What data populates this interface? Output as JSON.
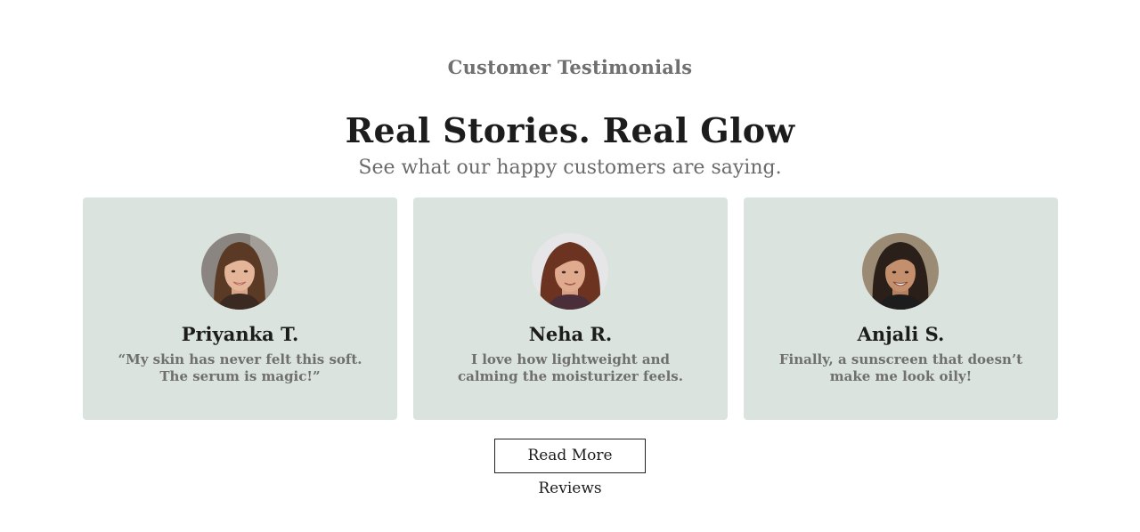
{
  "section": {
    "eyebrow": "Customer Testimonials",
    "headline": "Real Stories. Real Glow",
    "subhead": "See what our happy customers are saying."
  },
  "testimonials": [
    {
      "name": "Priyanka T.",
      "quote": "“My skin has never felt this soft. The serum is magic!”",
      "avatar_icon": "woman-portrait-long-brown-hair"
    },
    {
      "name": "Neha R.",
      "quote": "I love how lightweight and calming the moisturizer feels.",
      "avatar_icon": "woman-portrait-curly-brown-hair"
    },
    {
      "name": "Anjali S.",
      "quote": "Finally, a sunscreen that doesn’t make me look oily!",
      "avatar_icon": "woman-portrait-dark-braided-hair"
    }
  ],
  "cta": {
    "label": "Read More Reviews"
  },
  "colors": {
    "card_background": "#dae3dd",
    "page_background": "#ffffff",
    "heading_text": "#1c1c1c",
    "muted_text": "#6f6f6f",
    "button_border": "#222222"
  }
}
